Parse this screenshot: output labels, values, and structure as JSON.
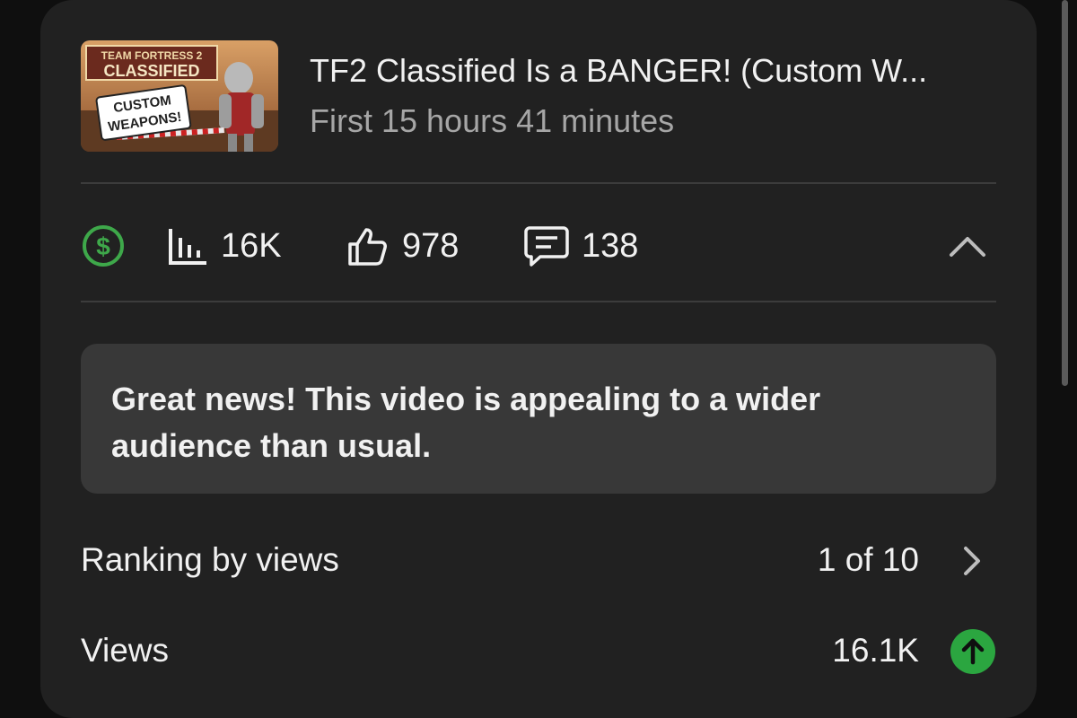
{
  "video": {
    "title": "TF2 Classified Is a BANGER! (Custom W...",
    "period": "First 15 hours 41 minutes",
    "thumbnail": {
      "line1": "TEAM FORTRESS 2",
      "line2": "CLASSIFIED",
      "line3": "CUSTOM",
      "line4": "WEAPONS!"
    }
  },
  "stats": {
    "monetization_icon": "dollar-circle-icon",
    "views": "16K",
    "likes": "978",
    "comments": "138",
    "collapse_icon": "chevron-up-icon"
  },
  "info": {
    "message": "Great news! This video is appealing to a wider audience than usual."
  },
  "metrics": [
    {
      "label": "Ranking by views",
      "value": "1 of 10",
      "icon": "chevron-right-icon"
    },
    {
      "label": "Views",
      "value": "16.1K",
      "icon": "arrow-up-circle-icon"
    }
  ],
  "colors": {
    "monetization_green": "#3ea84a",
    "trend_up_green": "#2ba640"
  }
}
